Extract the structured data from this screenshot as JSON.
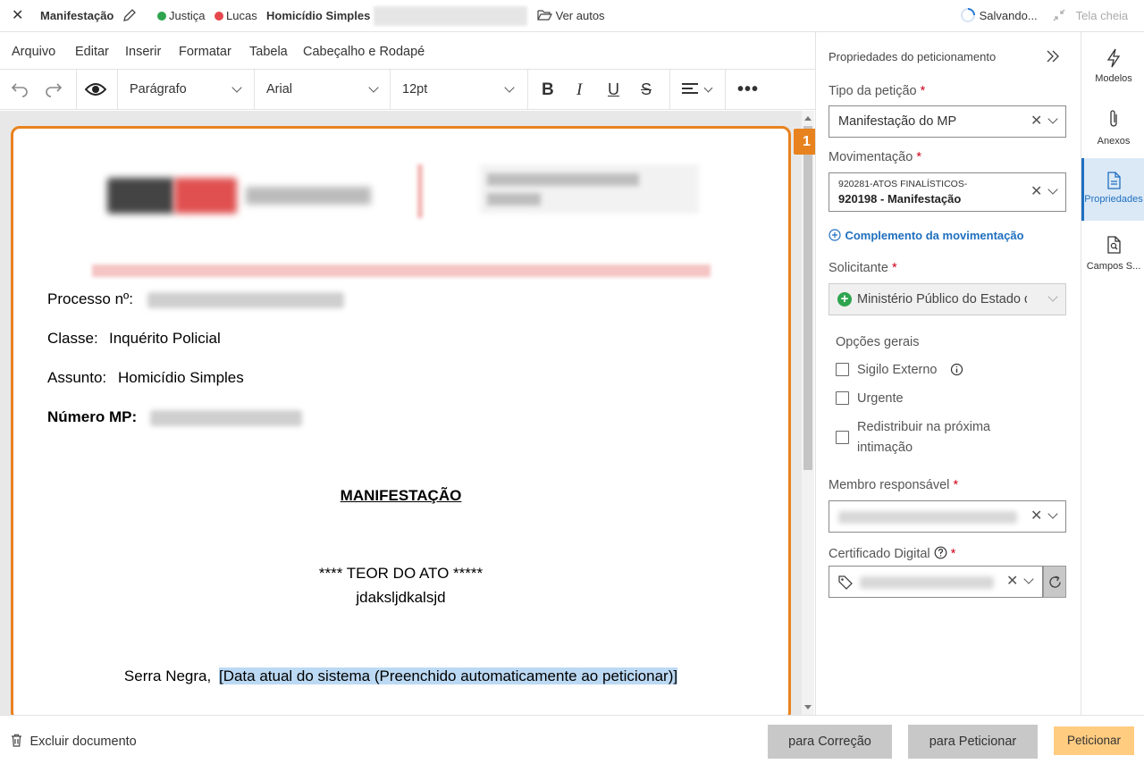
{
  "topbar": {
    "doc_title": "Manifestação",
    "tag_justica": "Justiça",
    "tag_lucas": "Lucas",
    "case_subject": "Homicídio Simples",
    "ver_autos": "Ver autos",
    "saving_status": "Salvando...",
    "fullscreen": "Tela cheia",
    "colors": {
      "justica_dot": "#2ea44f",
      "lucas_dot": "#e5484d"
    }
  },
  "menu": [
    "Arquivo",
    "Editar",
    "Inserir",
    "Formatar",
    "Tabela",
    "Cabeçalho e Rodapé"
  ],
  "toolbar": {
    "paragraph_style": "Parágrafo",
    "font_family": "Arial",
    "font_size": "12pt",
    "icons": [
      "undo-icon",
      "redo-icon",
      "eye-icon",
      "bold-icon",
      "italic-icon",
      "underline-icon",
      "strikethrough-icon",
      "align-left-icon",
      "more-icon"
    ]
  },
  "document": {
    "badge": "1",
    "processo_label": "Processo nº:",
    "classe_label": "Classe:",
    "classe_value": "Inquérito Policial",
    "assunto_label": "Assunto:",
    "assunto_value": "Homicídio Simples",
    "numero_mp_label": "Número MP:",
    "heading": "MANIFESTAÇÃO",
    "teor": "**** TEOR DO ATO *****",
    "content": "jdaksljdkalsjd",
    "city": "Serra Negra,",
    "date_placeholder": "[Data atual do sistema (Preenchido automaticamente ao peticionar)]",
    "accent_color": "#e8821e"
  },
  "panel": {
    "title": "Propriedades do peticionamento",
    "tipo_label": "Tipo da petição",
    "tipo_value": "Manifestação do MP",
    "mov_label": "Movimentação",
    "mov_line1": "920281-ATOS FINALÍSTICOS-",
    "mov_code": "920198",
    "mov_sep": " - ",
    "mov_name": "Manifestação",
    "complemento": "Complemento da movimentação",
    "solicitante_label": "Solicitante",
    "solicitante_value": "Ministério Público do Estado d",
    "opcoes_label": "Opções gerais",
    "sigilo": "Sigilo Externo",
    "urgente": "Urgente",
    "redistribuir_1": "Redistribuir na próxima",
    "redistribuir_2": "intimação",
    "membro_label": "Membro responsável",
    "certificado_label": "Certificado Digital",
    "required_mark": "*"
  },
  "rail": [
    {
      "label": "Modelos",
      "icon": "lightning-icon"
    },
    {
      "label": "Anexos",
      "icon": "paperclip-icon"
    },
    {
      "label": "Propriedades",
      "icon": "document-properties-icon"
    },
    {
      "label": "Campos S...",
      "icon": "document-search-icon"
    }
  ],
  "footer": {
    "delete": "Excluir documento",
    "para_correcao": "para Correção",
    "para_peticionar": "para Peticionar",
    "peticionar": "Peticionar",
    "peticionar_color": "#ffcc80"
  }
}
